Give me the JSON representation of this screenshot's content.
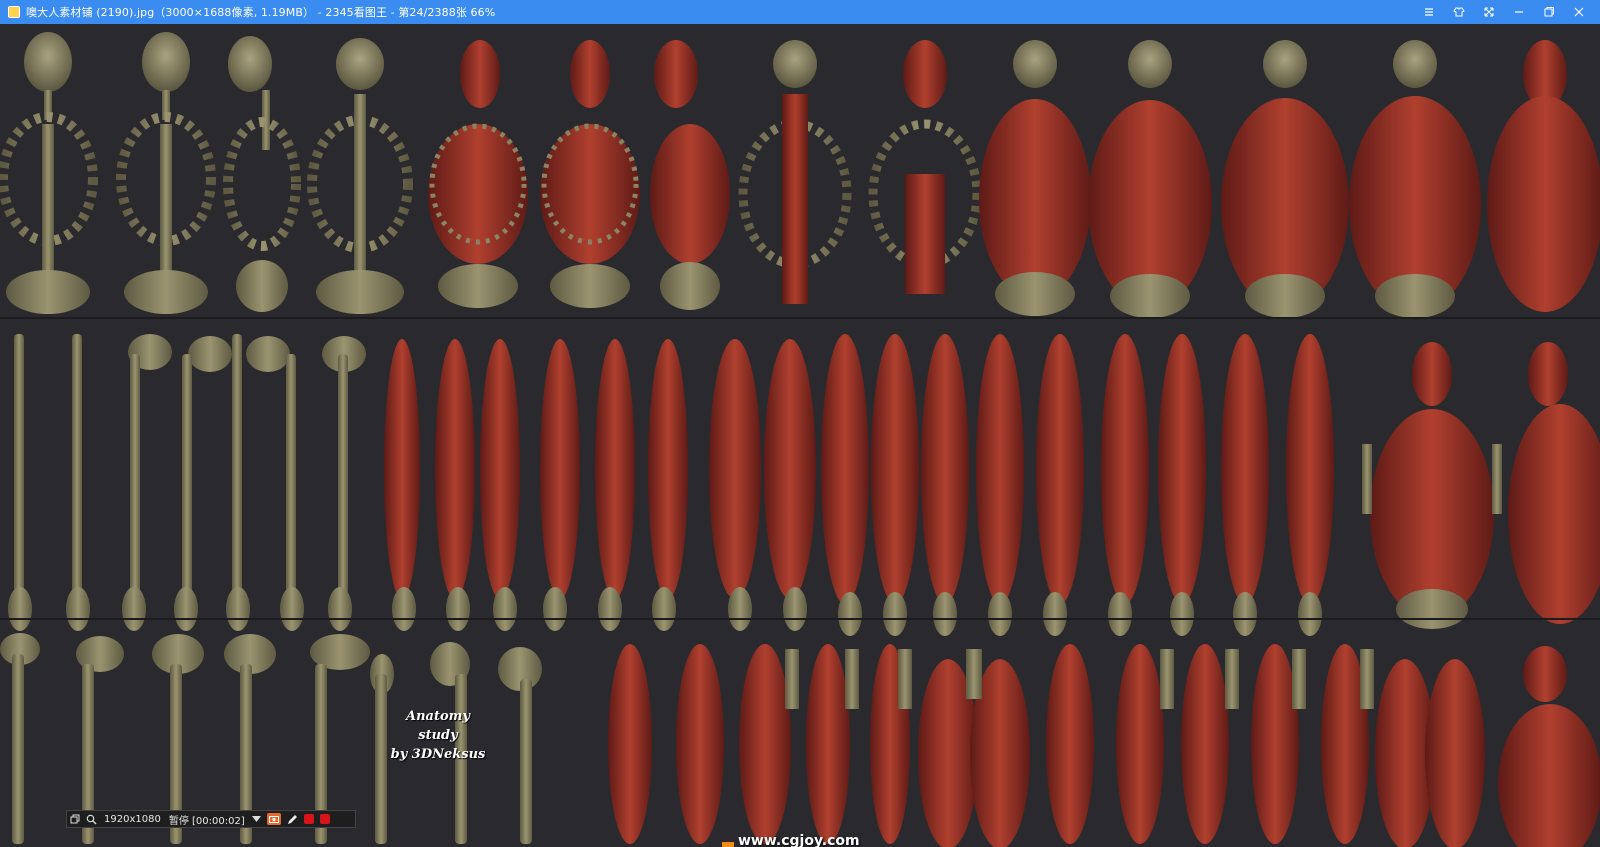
{
  "window": {
    "title": "噢大人素材铺 (2190).jpg（3000×1688像素, 1.19MB） - 2345看图王 - 第24/2388张 66%",
    "controls": [
      {
        "icon": "menu-icon"
      },
      {
        "icon": "skin-icon"
      },
      {
        "icon": "fullscreen-icon"
      },
      {
        "icon": "minimize-icon"
      },
      {
        "icon": "maximize-icon"
      },
      {
        "icon": "close-icon"
      }
    ],
    "title_bar_color": "#3a8cf0"
  },
  "image": {
    "caption_line1": "Anatomy study",
    "caption_line2": "by 3DNeksus",
    "colors": {
      "bone": "#8a8462",
      "muscle": "#9b3228",
      "background": "#2a2a2e"
    }
  },
  "capture_toolbar": {
    "resolution": "1920x1080",
    "status": "暂停 [00:00:02]"
  },
  "site_logo": {
    "text": "www.cgjoy.com"
  }
}
